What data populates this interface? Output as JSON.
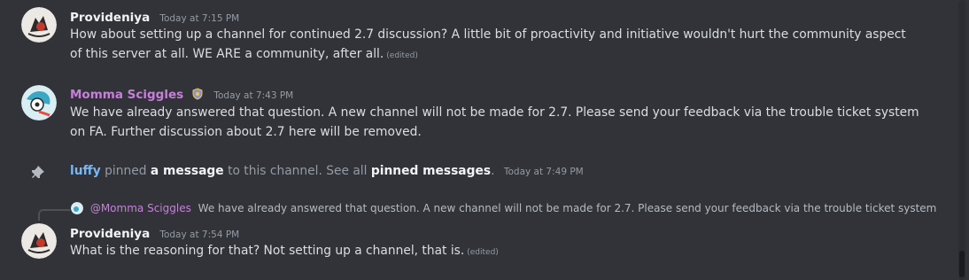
{
  "messages": [
    {
      "author": "Provideniya",
      "author_color": "#f2f3f5",
      "timestamp": "Today at 7:15 PM",
      "text": "How about setting up a channel for continued 2.7 discussion? A little bit of proactivity and initiative wouldn't hurt the community aspect of this server at all. WE ARE a community, after all.",
      "edited": "(edited)"
    },
    {
      "author": "Momma Sciggles",
      "author_color": "#c680d8",
      "timestamp": "Today at 7:43 PM",
      "text": "We have already answered that question. A new channel will not be made for 2.7. Please send your feedback via the trouble ticket system on FA. Further discussion about 2.7 here will be removed."
    }
  ],
  "system": {
    "user": "luffy",
    "pinned_text": "pinned",
    "a_message": "a message",
    "to_channel": "to this channel. See all",
    "pinned_messages": "pinned messages",
    "period": ".",
    "timestamp": "Today at 7:49 PM"
  },
  "reply": {
    "mention": "@Momma Sciggles",
    "preview": "We have already answered that question. A new channel will not be made for 2.7. Please send your feedback via the trouble ticket system"
  },
  "last_message": {
    "author": "Provideniya",
    "timestamp": "Today at 7:54 PM",
    "text": "What is the reasoning for that? Not setting up a channel, that is.",
    "edited": "(edited)"
  }
}
